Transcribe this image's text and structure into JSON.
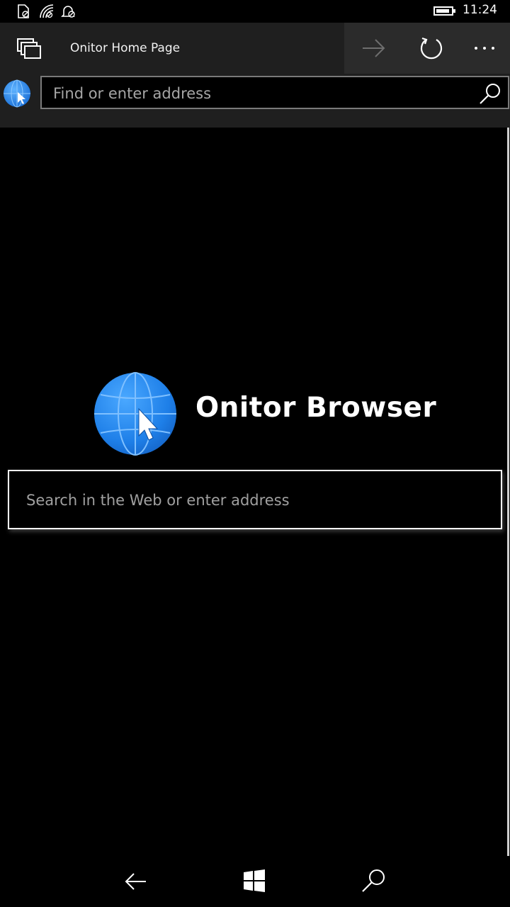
{
  "status_bar": {
    "time": "11:24",
    "icons": [
      "no-sim-icon",
      "wifi-icon",
      "quiet-hours-icon",
      "battery-icon"
    ],
    "battery_level": 0.9
  },
  "title_bar": {
    "page_title": "Onitor Home Page",
    "icons": [
      "tabs-icon",
      "forward-arrow-icon",
      "refresh-icon",
      "more-icon"
    ]
  },
  "address_bar": {
    "placeholder": "Find or enter address",
    "value": "",
    "icons": [
      "site-globe-icon",
      "search-icon"
    ]
  },
  "home": {
    "brand_name": "Onitor Browser",
    "search_placeholder": "Search in the Web or enter address",
    "search_value": "",
    "logo_icon": "globe-cursor-logo-icon"
  },
  "nav_bar": {
    "icons": [
      "back-arrow-icon",
      "windows-start-icon",
      "search-icon"
    ]
  },
  "colors": {
    "background": "#000000",
    "toolbar": "#1f1f1f",
    "toolbar_right": "#2b2b2b",
    "accent_blue": "#2a8cf0",
    "text": "#ffffff",
    "placeholder": "#a6a6a6"
  }
}
